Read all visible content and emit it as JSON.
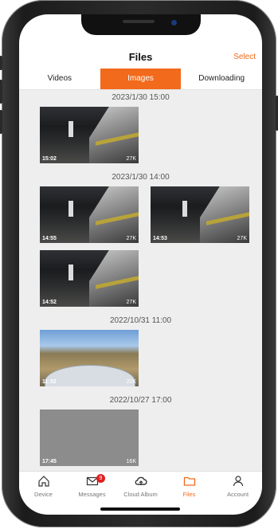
{
  "header": {
    "title": "Files",
    "select_label": "Select"
  },
  "tabs": [
    {
      "label": "Videos"
    },
    {
      "label": "Images",
      "active": true
    },
    {
      "label": "Downloading"
    }
  ],
  "groups": [
    {
      "date": "2023/1/30 15:00",
      "items": [
        {
          "time": "15:02",
          "size": "27K",
          "kind": "garage"
        }
      ]
    },
    {
      "date": "2023/1/30 14:00",
      "items": [
        {
          "time": "14:55",
          "size": "27K",
          "kind": "garage"
        },
        {
          "time": "14:53",
          "size": "27K",
          "kind": "garage"
        },
        {
          "time": "14:52",
          "size": "27K",
          "kind": "garage"
        }
      ]
    },
    {
      "date": "2022/10/31 11:00",
      "items": [
        {
          "time": "11:32",
          "size": "20K",
          "kind": "field"
        }
      ]
    },
    {
      "date": "2022/10/27 17:00",
      "items": [
        {
          "time": "17:45",
          "size": "16K",
          "kind": "gray"
        }
      ]
    }
  ],
  "tabbar": [
    {
      "label": "Device",
      "icon": "home-icon"
    },
    {
      "label": "Messages",
      "icon": "mail-icon",
      "badge": "9"
    },
    {
      "label": "Cloud Album",
      "icon": "cloud-icon"
    },
    {
      "label": "Files",
      "icon": "folder-icon",
      "active": true
    },
    {
      "label": "Account",
      "icon": "person-icon"
    }
  ],
  "colors": {
    "accent": "#f26a1b",
    "badge": "#e02020"
  }
}
